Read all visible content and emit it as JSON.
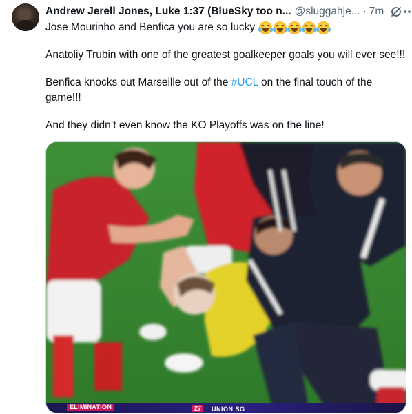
{
  "post": {
    "author_name": "Andrew Jerell Jones, Luke 1:37 (BlueSky too n...",
    "handle": "@sluggahje...",
    "separator": "·",
    "time": "7m",
    "icons": {
      "grok": "grok-icon",
      "more": "more-icon",
      "avatar": "avatar"
    },
    "line1": "Jose Mourinho and Benfica you are so lucky",
    "emoji_name": "face-with-tears-of-joy",
    "emoji_count": 5,
    "line2": "Anatoliy Trubin with one of the greatest goalkeeper goals you will ever see!!!",
    "line3_before": "Benfica knocks out Marseille out of the ",
    "hashtag": "#UCL",
    "line3_after": " on the final touch of the game!!!",
    "line4": "And they didn’t even know the KO Playoffs was on the line!"
  },
  "media": {
    "broadcast_label": "ELIMINATION",
    "score_number": "27",
    "team_text": "UNION SG"
  },
  "colors": {
    "text": "#0f1419",
    "secondary": "#536471",
    "link": "#1d9bf0",
    "pitch": "#3d8a35"
  }
}
